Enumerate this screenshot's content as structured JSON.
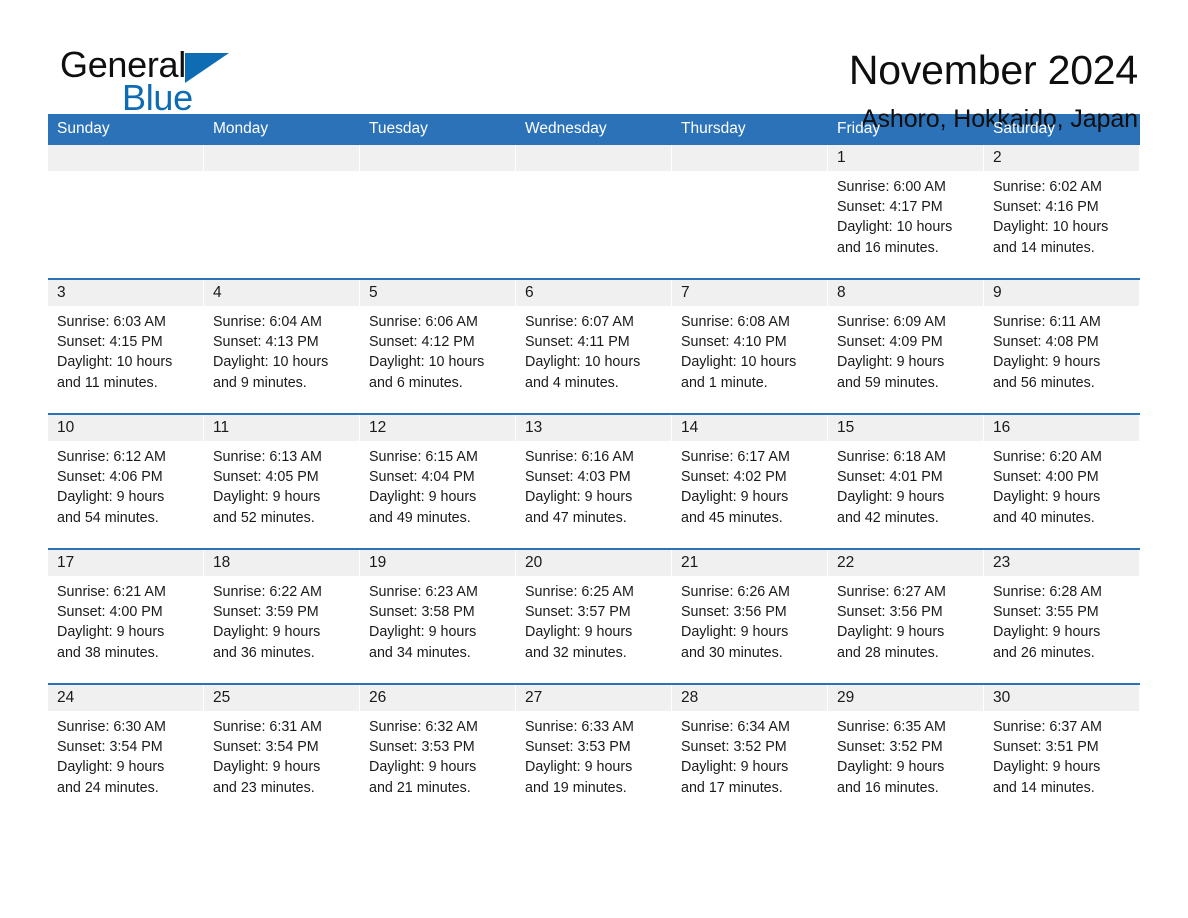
{
  "brand": {
    "name_line1": "General",
    "name_line2": "Blue",
    "triangle_color": "#0d6cb4"
  },
  "header": {
    "title": "November 2024",
    "subtitle": "Ashoro, Hokkaido, Japan"
  },
  "colors": {
    "header_blue": "#2c72b8",
    "daynum_band": "#f0f0f0",
    "text": "#1a1a1a",
    "brand_blue": "#0d6cb4"
  },
  "weekday_headers": [
    "Sunday",
    "Monday",
    "Tuesday",
    "Wednesday",
    "Thursday",
    "Friday",
    "Saturday"
  ],
  "weeks": [
    [
      {
        "day": "",
        "empty": true
      },
      {
        "day": "",
        "empty": true
      },
      {
        "day": "",
        "empty": true
      },
      {
        "day": "",
        "empty": true
      },
      {
        "day": "",
        "empty": true
      },
      {
        "day": "1",
        "sunrise": "Sunrise: 6:00 AM",
        "sunset": "Sunset: 4:17 PM",
        "daylight1": "Daylight: 10 hours",
        "daylight2": "and 16 minutes."
      },
      {
        "day": "2",
        "sunrise": "Sunrise: 6:02 AM",
        "sunset": "Sunset: 4:16 PM",
        "daylight1": "Daylight: 10 hours",
        "daylight2": "and 14 minutes."
      }
    ],
    [
      {
        "day": "3",
        "sunrise": "Sunrise: 6:03 AM",
        "sunset": "Sunset: 4:15 PM",
        "daylight1": "Daylight: 10 hours",
        "daylight2": "and 11 minutes."
      },
      {
        "day": "4",
        "sunrise": "Sunrise: 6:04 AM",
        "sunset": "Sunset: 4:13 PM",
        "daylight1": "Daylight: 10 hours",
        "daylight2": "and 9 minutes."
      },
      {
        "day": "5",
        "sunrise": "Sunrise: 6:06 AM",
        "sunset": "Sunset: 4:12 PM",
        "daylight1": "Daylight: 10 hours",
        "daylight2": "and 6 minutes."
      },
      {
        "day": "6",
        "sunrise": "Sunrise: 6:07 AM",
        "sunset": "Sunset: 4:11 PM",
        "daylight1": "Daylight: 10 hours",
        "daylight2": "and 4 minutes."
      },
      {
        "day": "7",
        "sunrise": "Sunrise: 6:08 AM",
        "sunset": "Sunset: 4:10 PM",
        "daylight1": "Daylight: 10 hours",
        "daylight2": "and 1 minute."
      },
      {
        "day": "8",
        "sunrise": "Sunrise: 6:09 AM",
        "sunset": "Sunset: 4:09 PM",
        "daylight1": "Daylight: 9 hours",
        "daylight2": "and 59 minutes."
      },
      {
        "day": "9",
        "sunrise": "Sunrise: 6:11 AM",
        "sunset": "Sunset: 4:08 PM",
        "daylight1": "Daylight: 9 hours",
        "daylight2": "and 56 minutes."
      }
    ],
    [
      {
        "day": "10",
        "sunrise": "Sunrise: 6:12 AM",
        "sunset": "Sunset: 4:06 PM",
        "daylight1": "Daylight: 9 hours",
        "daylight2": "and 54 minutes."
      },
      {
        "day": "11",
        "sunrise": "Sunrise: 6:13 AM",
        "sunset": "Sunset: 4:05 PM",
        "daylight1": "Daylight: 9 hours",
        "daylight2": "and 52 minutes."
      },
      {
        "day": "12",
        "sunrise": "Sunrise: 6:15 AM",
        "sunset": "Sunset: 4:04 PM",
        "daylight1": "Daylight: 9 hours",
        "daylight2": "and 49 minutes."
      },
      {
        "day": "13",
        "sunrise": "Sunrise: 6:16 AM",
        "sunset": "Sunset: 4:03 PM",
        "daylight1": "Daylight: 9 hours",
        "daylight2": "and 47 minutes."
      },
      {
        "day": "14",
        "sunrise": "Sunrise: 6:17 AM",
        "sunset": "Sunset: 4:02 PM",
        "daylight1": "Daylight: 9 hours",
        "daylight2": "and 45 minutes."
      },
      {
        "day": "15",
        "sunrise": "Sunrise: 6:18 AM",
        "sunset": "Sunset: 4:01 PM",
        "daylight1": "Daylight: 9 hours",
        "daylight2": "and 42 minutes."
      },
      {
        "day": "16",
        "sunrise": "Sunrise: 6:20 AM",
        "sunset": "Sunset: 4:00 PM",
        "daylight1": "Daylight: 9 hours",
        "daylight2": "and 40 minutes."
      }
    ],
    [
      {
        "day": "17",
        "sunrise": "Sunrise: 6:21 AM",
        "sunset": "Sunset: 4:00 PM",
        "daylight1": "Daylight: 9 hours",
        "daylight2": "and 38 minutes."
      },
      {
        "day": "18",
        "sunrise": "Sunrise: 6:22 AM",
        "sunset": "Sunset: 3:59 PM",
        "daylight1": "Daylight: 9 hours",
        "daylight2": "and 36 minutes."
      },
      {
        "day": "19",
        "sunrise": "Sunrise: 6:23 AM",
        "sunset": "Sunset: 3:58 PM",
        "daylight1": "Daylight: 9 hours",
        "daylight2": "and 34 minutes."
      },
      {
        "day": "20",
        "sunrise": "Sunrise: 6:25 AM",
        "sunset": "Sunset: 3:57 PM",
        "daylight1": "Daylight: 9 hours",
        "daylight2": "and 32 minutes."
      },
      {
        "day": "21",
        "sunrise": "Sunrise: 6:26 AM",
        "sunset": "Sunset: 3:56 PM",
        "daylight1": "Daylight: 9 hours",
        "daylight2": "and 30 minutes."
      },
      {
        "day": "22",
        "sunrise": "Sunrise: 6:27 AM",
        "sunset": "Sunset: 3:56 PM",
        "daylight1": "Daylight: 9 hours",
        "daylight2": "and 28 minutes."
      },
      {
        "day": "23",
        "sunrise": "Sunrise: 6:28 AM",
        "sunset": "Sunset: 3:55 PM",
        "daylight1": "Daylight: 9 hours",
        "daylight2": "and 26 minutes."
      }
    ],
    [
      {
        "day": "24",
        "sunrise": "Sunrise: 6:30 AM",
        "sunset": "Sunset: 3:54 PM",
        "daylight1": "Daylight: 9 hours",
        "daylight2": "and 24 minutes."
      },
      {
        "day": "25",
        "sunrise": "Sunrise: 6:31 AM",
        "sunset": "Sunset: 3:54 PM",
        "daylight1": "Daylight: 9 hours",
        "daylight2": "and 23 minutes."
      },
      {
        "day": "26",
        "sunrise": "Sunrise: 6:32 AM",
        "sunset": "Sunset: 3:53 PM",
        "daylight1": "Daylight: 9 hours",
        "daylight2": "and 21 minutes."
      },
      {
        "day": "27",
        "sunrise": "Sunrise: 6:33 AM",
        "sunset": "Sunset: 3:53 PM",
        "daylight1": "Daylight: 9 hours",
        "daylight2": "and 19 minutes."
      },
      {
        "day": "28",
        "sunrise": "Sunrise: 6:34 AM",
        "sunset": "Sunset: 3:52 PM",
        "daylight1": "Daylight: 9 hours",
        "daylight2": "and 17 minutes."
      },
      {
        "day": "29",
        "sunrise": "Sunrise: 6:35 AM",
        "sunset": "Sunset: 3:52 PM",
        "daylight1": "Daylight: 9 hours",
        "daylight2": "and 16 minutes."
      },
      {
        "day": "30",
        "sunrise": "Sunrise: 6:37 AM",
        "sunset": "Sunset: 3:51 PM",
        "daylight1": "Daylight: 9 hours",
        "daylight2": "and 14 minutes."
      }
    ]
  ]
}
